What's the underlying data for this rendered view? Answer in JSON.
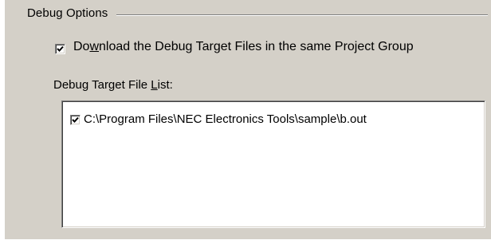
{
  "group": {
    "title": "Debug Options"
  },
  "download_option": {
    "label_before": "Do",
    "label_accel": "w",
    "label_after": "nload the Debug Target Files in the same Project Group",
    "checked": true
  },
  "file_list": {
    "label_before": "Debug Target File ",
    "label_accel": "L",
    "label_after": "ist:",
    "items": [
      {
        "path": "C:\\Program Files\\NEC Electronics Tools\\sample\\b.out",
        "checked": true
      }
    ]
  },
  "colors": {
    "dialog_face": "#d4d0c8",
    "list_background": "#ffffff",
    "shadow": "#808080",
    "dark_shadow": "#404040",
    "highlight": "#ffffff"
  },
  "icons": {
    "check": "checkmark-icon"
  }
}
